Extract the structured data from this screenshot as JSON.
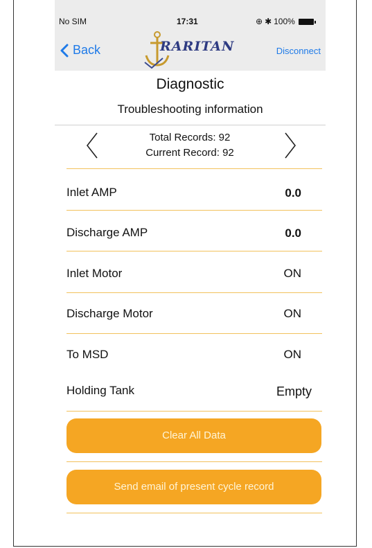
{
  "status_bar": {
    "carrier": "No SIM",
    "time": "17:31",
    "battery": "100%"
  },
  "nav_bar": {
    "back_label": "Back",
    "logo_text": "RARITAN",
    "disconnect_label": "Disconnect"
  },
  "header": {
    "title": "Diagnostic",
    "subtitle": "Troubleshooting information"
  },
  "records": {
    "total": "Total Records: 92",
    "current": "Current Record: 92"
  },
  "rows": [
    {
      "label": "Inlet AMP",
      "value": "0.0"
    },
    {
      "label": "Discharge AMP",
      "value": "0.0"
    },
    {
      "label": "Inlet Motor",
      "value": "ON"
    },
    {
      "label": "Discharge Motor",
      "value": "ON"
    },
    {
      "label": "To MSD",
      "value": "ON"
    },
    {
      "label": "Holding Tank",
      "value": "Empty"
    }
  ],
  "buttons": {
    "clear": "Clear All Data",
    "email": "Send email of present cycle record"
  },
  "colors": {
    "accent_orange": "#f5a623",
    "link_blue": "#1e7ae8",
    "divider_orange": "#f2c15b"
  }
}
